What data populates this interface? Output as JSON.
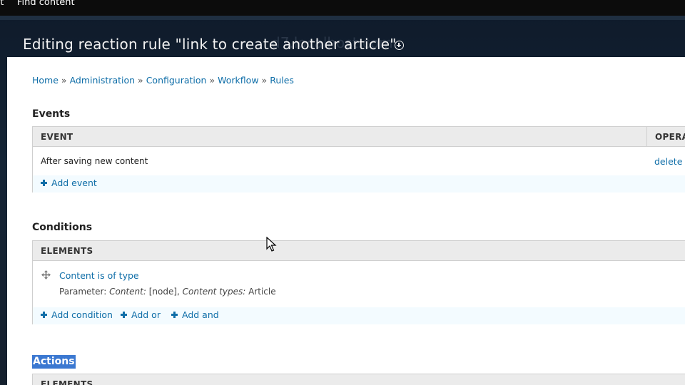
{
  "toolbar": {
    "item_left": "nt",
    "item_find": "Find content"
  },
  "header": {
    "title": "Editing reaction rule \"link to create another article\"",
    "watermark": "d7.localhost.com"
  },
  "breadcrumb": [
    "Home",
    "Administration",
    "Configuration",
    "Workflow",
    "Rules"
  ],
  "breadcrumb_sep": "»",
  "events": {
    "heading": "Events",
    "col_event": "EVENT",
    "col_operations": "OPERATIONS",
    "rows": [
      {
        "name": "After saving new content",
        "op": "delete"
      }
    ],
    "add_event": "Add event"
  },
  "conditions": {
    "heading": "Conditions",
    "col_elements": "ELEMENTS",
    "item": {
      "label": "Content is of type",
      "param_prefix": "Parameter:",
      "param_k1": "Content:",
      "param_v1": "[node],",
      "param_k2": "Content types:",
      "param_v2": "Article"
    },
    "add_condition": "Add condition",
    "add_or": "Add or",
    "add_and": "Add and"
  },
  "actions": {
    "heading": "Actions",
    "col_elements": "ELEMENTS"
  },
  "colors": {
    "link": "#0f6ea8",
    "highlight": "#3b78d1",
    "header_bg": "#15202e"
  }
}
